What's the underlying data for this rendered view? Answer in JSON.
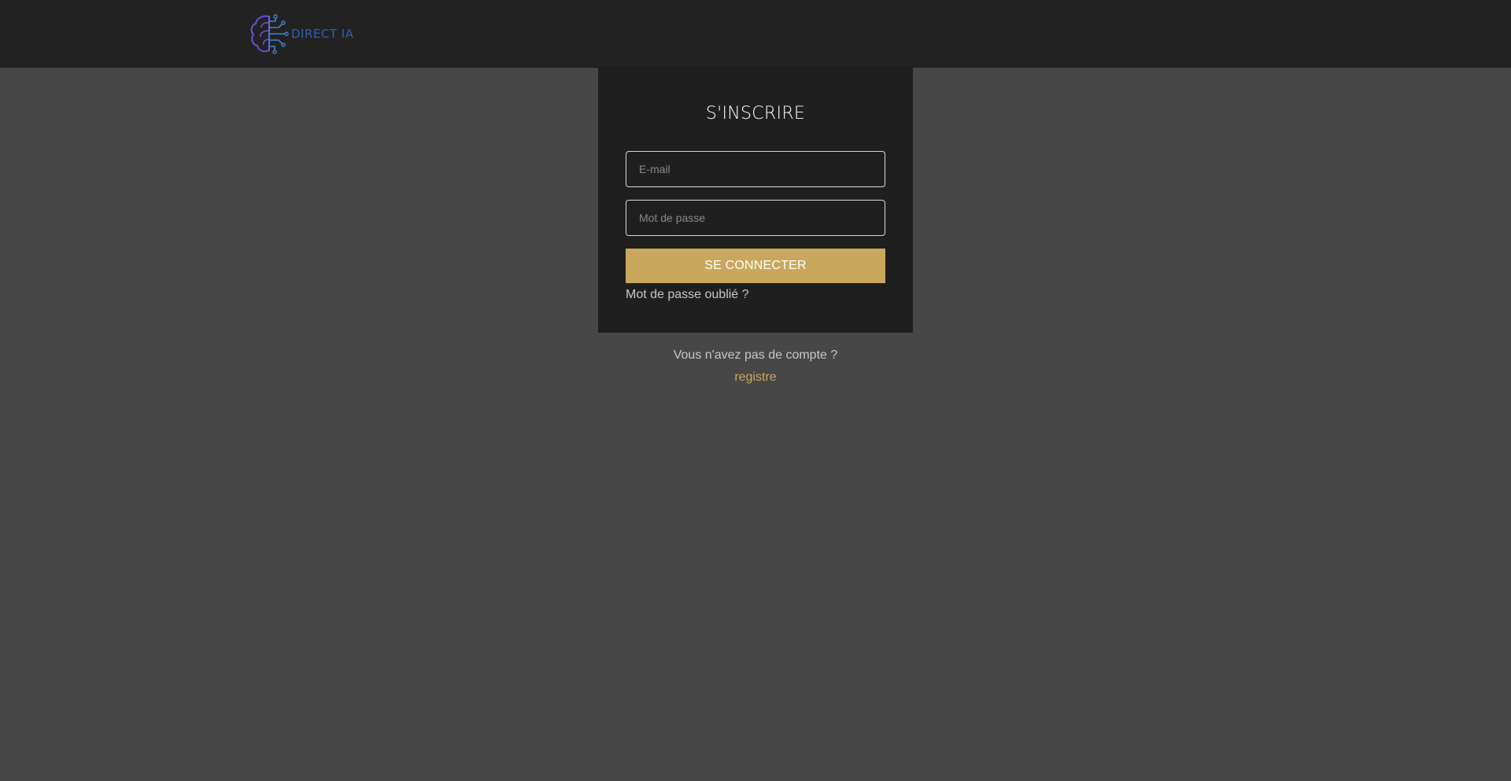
{
  "header": {
    "logo_text": "DIRECT IA",
    "logo_icon": "brain-circuit-icon"
  },
  "login": {
    "title": "S'INSCRIRE",
    "email_placeholder": "E-mail",
    "email_value": "",
    "password_placeholder": "Mot de passe",
    "password_value": "",
    "submit_label": "SE CONNECTER",
    "forgot_label": "Mot de passe oublié ?"
  },
  "signup": {
    "prompt": "Vous n'avez pas de compte ?",
    "link_label": "registre"
  },
  "colors": {
    "background": "#474747",
    "topbar": "#222222",
    "card": "#1f1f1f",
    "accent": "#c9a75c",
    "logo_blue": "#2f5fb7",
    "logo_purple": "#6b4fd8"
  }
}
